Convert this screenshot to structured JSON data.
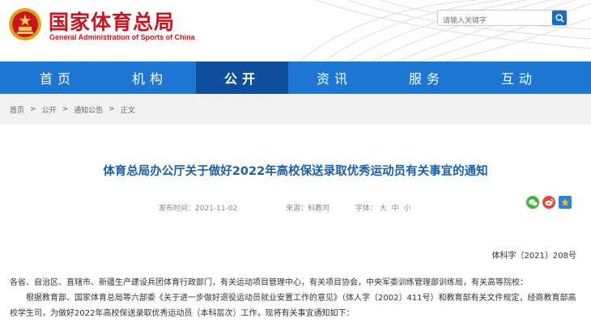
{
  "header": {
    "title": "国家体育总局",
    "subtitle": "General Administration of Sports of China",
    "search_placeholder": "请输入关键字"
  },
  "nav": {
    "items": [
      {
        "label": "首页",
        "active": false
      },
      {
        "label": "机构",
        "active": false
      },
      {
        "label": "公开",
        "active": true
      },
      {
        "label": "资讯",
        "active": false
      },
      {
        "label": "服务",
        "active": false
      },
      {
        "label": "互动",
        "active": false
      }
    ]
  },
  "breadcrumb": {
    "items": [
      "首页",
      "公开",
      "通知公告",
      "正文"
    ],
    "separator": ">"
  },
  "article": {
    "title": "体育总局办公厅关于做好2022年高校保送录取优秀运动员有关事宜的通知",
    "date_label": "发布时间：2021-11-02",
    "source_label": "来源：科教司",
    "font_label": "字体：",
    "font_sizes": [
      "大",
      "中",
      "小"
    ],
    "doc_number": "体科字〔2021〕208号",
    "paragraphs": [
      "各省、自治区、直辖市、新疆生产建设兵团体育行政部门，有关运动项目管理中心，有关项目协会，中央军委训练管理部训练局，有关高等院校：",
      "根据教育部、国家体育总局等六部委《关于进一步做好退役运动员就业安置工作的意见》（体人字〔2002〕411号）和教育部有关文件规定，经商教育部高校学生司，为做好2022年高校保送录取优秀运动员（本科层次）工作，现将有关事宜通知如下："
    ]
  },
  "share": {
    "icons": [
      "wechat-icon",
      "weibo-icon",
      "qzone-icon"
    ]
  },
  "colors": {
    "brand_red": "#c8161d",
    "nav_blue": "#1d77d2",
    "nav_active": "#0f4e9c",
    "title_blue": "#1b5fa8"
  }
}
